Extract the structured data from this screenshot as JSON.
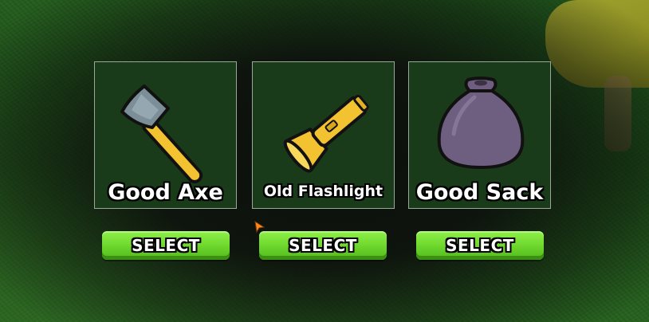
{
  "scene": {
    "background": "grass-field",
    "colors": {
      "card_bg": "#1a3b1a",
      "card_border": "#9aa89a",
      "button_green": "#6fd82e",
      "title_text": "#ffffff"
    }
  },
  "items": [
    {
      "name": "Good Axe",
      "icon": "axe-icon",
      "button_label": "SELECT"
    },
    {
      "name": "Old Flashlight",
      "icon": "flashlight-icon",
      "button_label": "SELECT"
    },
    {
      "name": "Good Sack",
      "icon": "sack-icon",
      "button_label": "SELECT"
    }
  ]
}
